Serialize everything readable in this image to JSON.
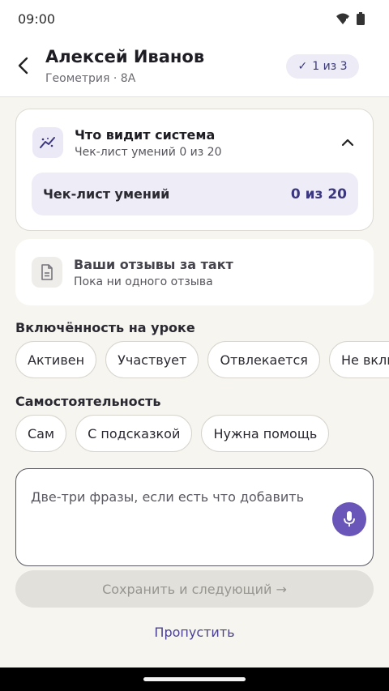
{
  "status_bar": {
    "time": "09:00"
  },
  "header": {
    "student_name": "Алексей Иванов",
    "student_meta": "Геометрия · 8А",
    "progress": {
      "check": "✓",
      "label": "1 из 3"
    }
  },
  "system_card": {
    "title": "Что видит система",
    "subtitle": "Чек-лист умений 0 из 20",
    "checklist_label": "Чек-лист умений",
    "checklist_value": "0 из 20"
  },
  "feedback_card": {
    "title": "Ваши отзывы за такт",
    "subtitle": "Пока ни одного отзыва"
  },
  "engagement": {
    "title": "Включённость на уроке",
    "options": [
      "Активен",
      "Участвует",
      "Отвлекается",
      "Не вклю"
    ]
  },
  "independence": {
    "title": "Самостоятельность",
    "options": [
      "Сам",
      "С подсказкой",
      "Нужна помощь"
    ]
  },
  "note": {
    "placeholder": "Две-три фразы, если есть что добавить"
  },
  "actions": {
    "save_label": "Сохранить и следующий →",
    "skip_label": "Пропустить"
  },
  "colors": {
    "accent": "#6a55b8",
    "accent_text": "#3b3680",
    "background": "#f6f5ef"
  }
}
